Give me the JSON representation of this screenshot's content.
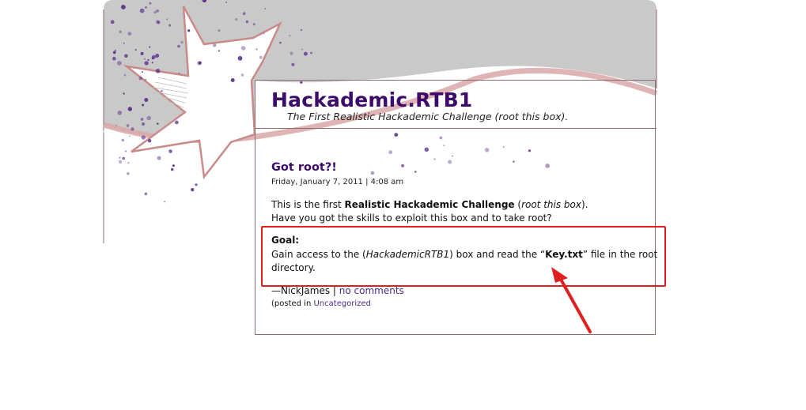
{
  "site": {
    "title": "Hackademic.RTB1",
    "description": "The First Realistic Hackademic Challenge (root this box)."
  },
  "post": {
    "title": "Got root?!",
    "date": "Friday, January 7, 2011 | 4:08 am",
    "intro": {
      "line1_pre": "This is the first ",
      "line1_bold": "Realistic Hackademic Challenge",
      "line1_mid": " (",
      "line1_italic": "root this box",
      "line1_post": ").",
      "line2": "Have you got the skills to exploit this box and to take root?"
    },
    "goal": {
      "label": "Goal:",
      "line1_pre": "Gain access to the (",
      "line1_italic": "HackademicRTB1",
      "line1_mid": ") box and read the “",
      "line1_bold": "Key.txt",
      "line1_post": "” file in the root",
      "line2": "directory."
    },
    "byline": {
      "author": "—NickJames | ",
      "comments_link": "no comments"
    },
    "meta": {
      "prefix": "(posted in ",
      "category_link": "Uncategorized"
    }
  },
  "colors": {
    "title": "#3d0a6b",
    "link": "#4b2b8a",
    "annotation": "#e02020",
    "header_gray": "#c9c9c9",
    "star_outline": "#c98a8a",
    "dots": "#5b2d8a"
  },
  "icons": {
    "annotation_arrow": "red-arrow-icon",
    "starburst": "starburst-decoration"
  }
}
